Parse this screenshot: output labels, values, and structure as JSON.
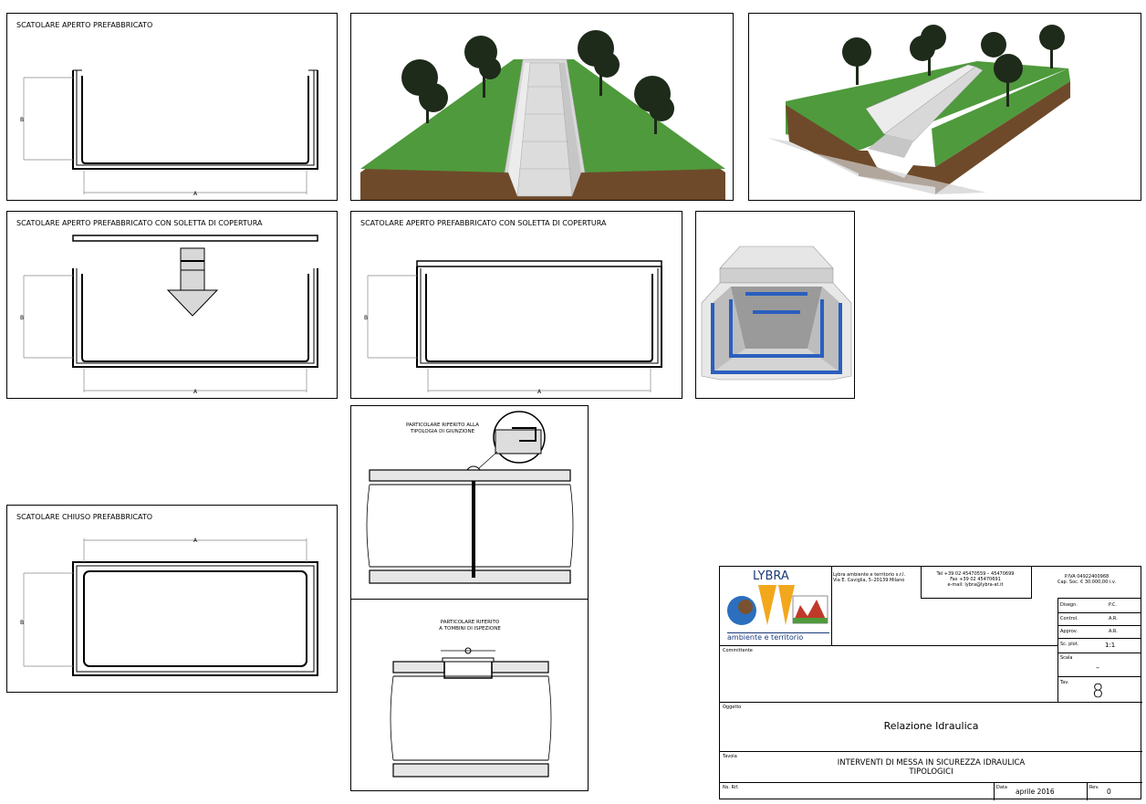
{
  "panels": {
    "open_title": "SCATOLARE APERTO PREFABBRICATO",
    "open_cover_title": "SCATOLARE APERTO PREFABBRICATO CON SOLETTA DI COPERTURA",
    "open_cover_assembled_title": "SCATOLARE APERTO PREFABBRICATO CON SOLETTA DI COPERTURA",
    "closed_title": "SCATOLARE CHIUSO PREFABBRICATO",
    "dim_width": "A",
    "dim_height": "B"
  },
  "details": {
    "joint_label_1": "PARTICOLARE RIFERITO ALLA",
    "joint_label_2": "TIPOLOGIA DI GIUNZIONE",
    "inspection_label_1": "PARTICOLARE RIFERITO",
    "inspection_label_2": "A TOMBINI DI ISPEZIONE"
  },
  "title_block": {
    "logo_top": "LYBRA",
    "logo_bottom": "ambiente e territorio",
    "company_line_1": "Lybra ambiente e territorio s.r.l.",
    "company_line_2": "Via E. Caviglia, 5–20139 Milano",
    "tel": "Tel +39 02 45470559 – 45470699",
    "fax": "Fax +39 02 45470691",
    "email": "e-mail: lybra@lybra-at.it",
    "piva": "P.IVA 04922400968",
    "capital": "Cap. Soc. € 30.000,00 i.v.",
    "disegn_label": "Disegn.",
    "disegn_value": "P.C.",
    "control_label": "Control.",
    "control_value": "A.R.",
    "approv_label": "Approv.",
    "approv_value": "A.R.",
    "sc_plot_label": "Sc. plot.",
    "sc_plot_value": "1:1",
    "scala_label": "Scala",
    "scala_value": "–",
    "committente_label": "Committente",
    "tav_label": "Tav.",
    "tav_value": "8",
    "oggetto_label": "Oggetto",
    "oggetto_value": "Relazione Idraulica",
    "tavola_label": "Tavola",
    "tavola_line_1": "INTERVENTI DI MESSA IN SICUREZZA IDRAULICA",
    "tavola_line_2": "TIPOLOGICI",
    "nrif_label": "Ns. Rif.",
    "data_label": "Data",
    "data_value": "aprile 2016",
    "rev_label": "Rev.",
    "rev_value": "0"
  },
  "colors": {
    "grass": "#4f9a3c",
    "soil": "#7a5230",
    "concrete": "#d8d8d8",
    "blue_joint": "#2a5fbf",
    "logo_orange": "#f2a81d",
    "logo_blue": "#2b6fbe"
  }
}
